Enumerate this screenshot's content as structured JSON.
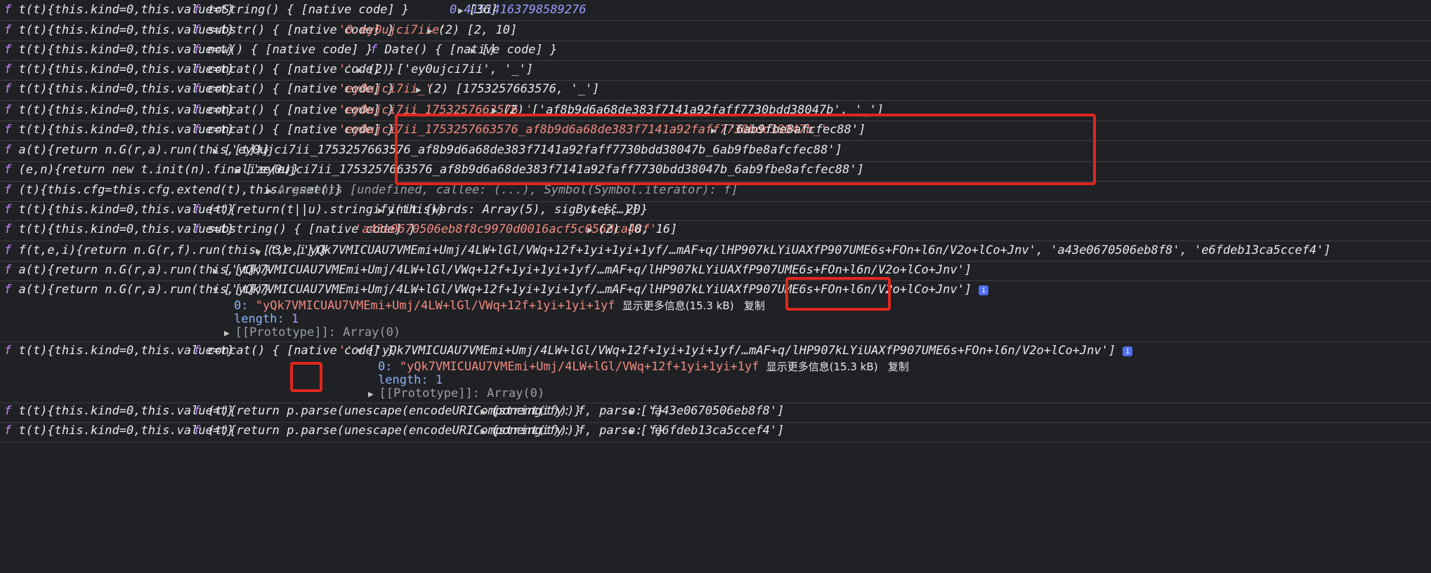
{
  "rows": [
    {
      "fn1": "t(t){this.kind=0,this.value=t}",
      "fn2": "toString() { [native code] }",
      "val1": "0.41514163798589276",
      "val1_class": "num",
      "arr": "[36]"
    },
    {
      "fn1": "t(t){this.kind=0,this.value=t}",
      "fn2": "substr() { [native code] }",
      "val1": "'0.ey0ujci7iie'",
      "val1_class": "str",
      "arr": "(2) [2, 10]"
    },
    {
      "fn1": "t(t){this.kind=0,this.value=t}",
      "fn2": "now() { [native code] }",
      "fn3": "Date() { [native code] }",
      "arr": "[]"
    },
    {
      "fn1": "t(t){this.kind=0,this.value=t}",
      "fn2": "concat() { [native code] }",
      "val1": "''",
      "val1_class": "str",
      "arr": "(2) ['ey0ujci7ii', '_']"
    },
    {
      "fn1": "t(t){this.kind=0,this.value=t}",
      "fn2": "concat() { [native code] }",
      "val1": "'ey0ujci7ii_'",
      "val1_class": "str",
      "arr": "(2) [1753257663576, '_']"
    },
    {
      "fn1": "t(t){this.kind=0,this.value=t}",
      "fn2": "concat() { [native code] }",
      "val1": "'ey0ujci7ii_1753257663576_'",
      "val1_class": "str",
      "arr": "(2) ['af8b9d6a68de383f7141a92faff7730bdd38047b', '_']"
    },
    {
      "fn1": "t(t){this.kind=0,this.value=t}",
      "fn2": "concat() { [native code] }",
      "val1": "'ey0ujci7ii_1753257663576_af8b9d6a68de383f7141a92faff7730bdd38047b_'",
      "val1_class": "str",
      "arr": "['6ab9fbe8afcfec88']"
    },
    {
      "fn1": "a(t){return n.G(r,a).run(this,[t])}",
      "arr": "['ey0ujci7ii_1753257663576_af8b9d6a68de383f7141a92faff7730bdd38047b_6ab9fbe8afcfec88']"
    },
    {
      "fn1": "(e,n){return new t.init(n).finalize(e)}",
      "arr": "['ey0ujci7ii_1753257663576_af8b9d6a68de383f7141a92faff7730bdd38047b_6ab9fbe8afcfec88']"
    },
    {
      "fn1": "(t){this.cfg=this.cfg.extend(t),this.reset()}",
      "arr": "Arguments [undefined, callee: (...), Symbol(Symbol.iterator): f]"
    },
    {
      "fn1": "t(t){this.kind=0,this.value=t}",
      "fn2": "(t){return(t||u).stringify(this)}",
      "arr": "init {words: Array(5), sigBytes: 20}",
      "arr2": "[{…}]"
    },
    {
      "fn1": "t(t){this.kind=0,this.value=t}",
      "fn2": "substring() { [native code] }",
      "val1": "'a43e0670506eb8f8c9970d0016acf5c056dca48f'",
      "val1_class": "str",
      "arr": "(2) [0, 16]"
    },
    {
      "fn1": "f(t,e,i){return n.G(r,f).run(this,[t,e,i])}",
      "arr": "(3) ['yQk7VMICUAU7VMEmi+Umj/4LW+lGl/VWq+12f+1yi+1yi+1yf/…mAF+q/lHP907kLYiUAXfP907UME6s+FOn+l6n/V2o+lCo+Jnv', 'a43e0670506eb8f8', 'e6fdeb13ca5ccef4']"
    },
    {
      "fn1": "a(t){return n.G(r,a).run(this,[t])}",
      "arr": "['yQk7VMICUAU7VMEmi+Umj/4LW+lGl/VWq+12f+1yi+1yi+1yf/…mAF+q/lHP907kLYiUAXfP907UME6s+FOn+l6n/V2o+lCo+Jnv']"
    },
    {
      "fn1": "a(t){return n.G(r,a).run(this,[t])}",
      "arr": "['yQk7VMICUAU7VMEmi+Umj/4LW+lGl/VWq+12f+1yi+1yi+1yf/…mAF+q/lHP907kLYiUAXfP907UME6s+FOn+l6n/V2o+lCo+Jnv']",
      "expanded": {
        "item0_key": "0:",
        "item0_val": "\"yQk7VMICUAU7VMEmi+Umj/4LW+lGl/VWq+12f+1yi+1yi+1yf",
        "more": "显示更多信息(15.3 kB)",
        "copy": "复制",
        "length_key": "length:",
        "length_val": "1",
        "proto": "[[Prototype]]: Array(0)"
      }
    },
    {
      "fn1": "t(t){this.kind=0,this.value=t}",
      "fn2": "concat() { [native code] }",
      "val1": "''",
      "val1_class": "str",
      "arr": "['yQk7VMICUAU7VMEmi+Umj/4LW+lGl/VWq+12f+1yi+1yi+1yf/…mAF+q/lHP907kLYiUAXfP907UME6s+FOn+l6n/V2o+lCo+Jnv']",
      "expanded": {
        "item0_key": "0:",
        "item0_val": "\"yQk7VMICUAU7VMEmi+Umj/4LW+lGl/VWq+12f+1yi+1yi+1yf",
        "more": "显示更多信息(15.3 kB)",
        "copy": "复制",
        "length_key": "length:",
        "length_val": "1",
        "proto": "[[Prototype]]: Array(0)"
      }
    },
    {
      "fn1": "t(t){this.kind=0,this.value=t}",
      "fn2": "(t){return p.parse(unescape(encodeURIComponent(t)))}",
      "obj": "{stringify: f, parse: f}",
      "arr": "['a43e0670506eb8f8']"
    },
    {
      "fn1": "t(t){this.kind=0,this.value=t}",
      "fn2": "(t){return p.parse(unescape(encodeURIComponent(t)))}",
      "obj": "{stringify: f, parse: f}",
      "arr": "['e6fdeb13ca5ccef4']"
    }
  ],
  "glyphs": {
    "f": "f",
    "collapsed": "▶",
    "expanded": "▼",
    "info": "i"
  },
  "colors": {
    "background": "#202124",
    "function": "#c58af9",
    "string": "#f28b82",
    "number": "#9a9eff",
    "key": "#8ab4f8",
    "highlight_box": "#e0271f"
  }
}
